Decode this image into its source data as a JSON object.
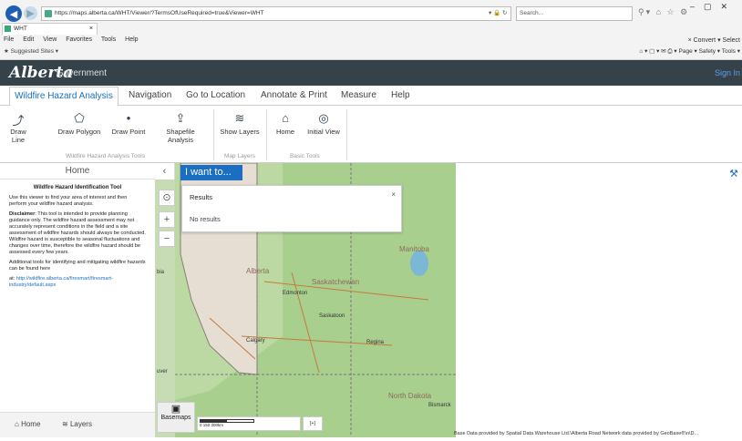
{
  "browser": {
    "url": "https://maps.alberta.ca/WHT/Viewer/?TermsOfUseRequired=true&Viewer=WHT",
    "search_placeholder": "Search...",
    "tab_title": "WHT",
    "menu": [
      "File",
      "Edit",
      "View",
      "Favorites",
      "Tools",
      "Help"
    ],
    "favorites": "Suggested Sites ▾",
    "convert": "Convert ▾",
    "select": "Select",
    "page_tools": "Page ▾  Safety ▾  Tools ▾"
  },
  "header": {
    "logo": "Alberta",
    "gov": "Government",
    "sign_in": "Sign In"
  },
  "tabs": [
    "Wildfire Hazard Analysis",
    "Navigation",
    "Go to Location",
    "Annotate & Print",
    "Measure",
    "Help"
  ],
  "tools": {
    "draw_line": "Draw Line",
    "draw_polygon": "Draw Polygon",
    "draw_point": "Draw Point",
    "shapefile": "Shapefile Analysis",
    "show_layers": "Show Layers",
    "home": "Home",
    "initial_view": "Initial View",
    "group1": "Wildfire Hazard Analysis Tools",
    "group2": "Map Layers",
    "group3": "Basic Tools"
  },
  "sidebar": {
    "title": "Home",
    "heading": "Wildfire Hazard Identification Tool",
    "intro": "Use this viewer to find your area of interest and then perform your wildfire hazard analysis.",
    "disclaimer_label": "Disclaimer",
    "disclaimer": ": This tool is intended to provide planning guidance only. The wildfire hazard assessment may not accurately represent conditions in the field and a site assessment of wildfire hazards should always be conducted. Wildfire hazard is susceptible to seasonal fluctuations and changes over time, therefore the wildfire hazard should be assessed every few years.",
    "additional": "Additional tools for identifying and mitigating wildfire hazards can be found here",
    "at": "at: ",
    "link": "http://wildfire.alberta.ca/firesmart/firesmart-industry/default.aspx",
    "foot_home": "Home",
    "foot_layers": "Layers"
  },
  "map": {
    "i_want_to": "I want to...",
    "results_title": "Results",
    "no_results": "No results",
    "basemaps": "Basemaps",
    "scale": "0    150    300km",
    "credit": "Base Data provided by Spatial Data Warehouse Ltd.\\Alberta Road Network data provided by GeoBase®\\n\\D...",
    "labels": [
      "Alberta",
      "Saskatchewan",
      "Manitoba",
      "North Dakota",
      "Edmonton",
      "Saskatoon",
      "Regina",
      "Calgary",
      "Bismarck"
    ],
    "left_edge": [
      "bia",
      "uver"
    ]
  }
}
